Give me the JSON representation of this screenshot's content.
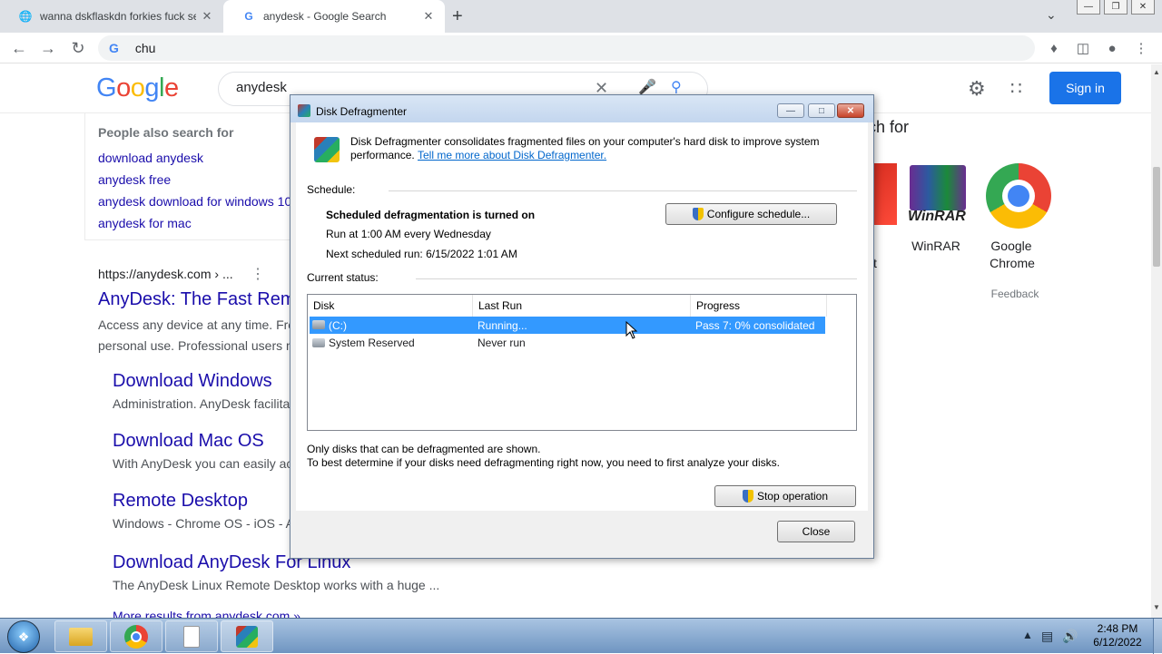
{
  "browser": {
    "tabs": [
      {
        "title": "wanna dskflaskdn forkies fuck se"
      },
      {
        "title": "anydesk - Google Search"
      }
    ],
    "new_tab": "+",
    "address": "chu",
    "address_prefix": "G"
  },
  "google": {
    "logo": "Google",
    "query": "anydesk",
    "sign_in": "Sign in",
    "people_also_search": {
      "title": "People also search for",
      "items": [
        "download anydesk",
        "anydesk free",
        "anydesk download for windows 10",
        "anydesk for mac"
      ]
    },
    "result": {
      "url": "https://anydesk.com › ...",
      "title": "AnyDesk: The Fast Remote Desktop",
      "snippet_lines": [
        "Access any device at any time. Free",
        "personal use. Professional users m"
      ],
      "sublinks": [
        {
          "title": "Download Windows",
          "snippet": "Administration. AnyDesk facilita"
        },
        {
          "title": "Download Mac OS",
          "snippet": "With AnyDesk you can easily ac"
        },
        {
          "title": "Remote Desktop",
          "snippet": "Windows - Chrome OS - iOS - A"
        },
        {
          "title": "Download AnyDesk For Linux",
          "snippet": "The AnyDesk Linux Remote Desktop works with a huge ..."
        }
      ],
      "more_results": "More results from anydesk.com »"
    },
    "right_panel": {
      "heading": "ch for",
      "apps": [
        {
          "label": "WinRAR"
        },
        {
          "label_lines": [
            "Google",
            "Chrome"
          ]
        }
      ],
      "fragment_t": "t",
      "feedback": "Feedback"
    }
  },
  "dialog": {
    "title": "Disk Defragmenter",
    "intro_line1": "Disk Defragmenter consolidates fragmented files on your computer's hard disk to improve system",
    "intro_line2": "performance.",
    "intro_link": "Tell me more about Disk Defragmenter.",
    "schedule_label": "Schedule:",
    "schedule_status": "Scheduled defragmentation is turned on",
    "schedule_run": "Run at 1:00 AM every Wednesday",
    "schedule_next": "Next scheduled run: 6/15/2022 1:01 AM",
    "configure_button": "Configure schedule...",
    "current_status_label": "Current status:",
    "columns": [
      "Disk",
      "Last Run",
      "Progress"
    ],
    "disks": [
      {
        "disk": "(C:)",
        "last_run": "Running...",
        "progress": "Pass 7: 0% consolidated"
      },
      {
        "disk": "System Reserved",
        "last_run": "Never run",
        "progress": ""
      }
    ],
    "note_line1": "Only disks that can be defragmented are shown.",
    "note_line2": "To best determine if your disks need defragmenting right now, you need to first analyze your disks.",
    "stop_button": "Stop operation",
    "close_button": "Close"
  },
  "taskbar": {
    "time": "2:48 PM",
    "date": "6/12/2022"
  },
  "colors": {
    "google_blue": "#1a73e8",
    "link": "#1a0dab",
    "selection": "#3399ff"
  }
}
